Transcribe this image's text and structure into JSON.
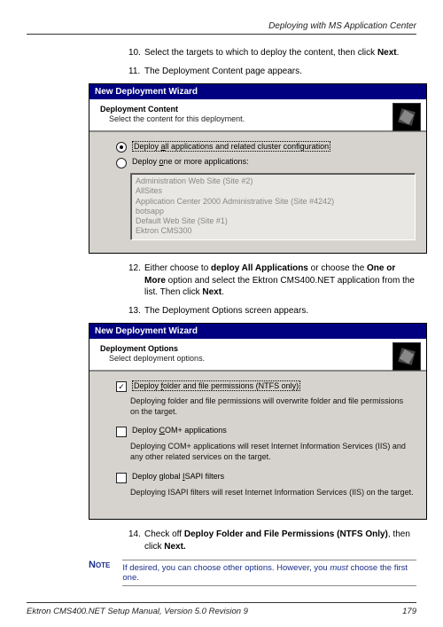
{
  "doc_header": "Deploying with MS Application Center",
  "steps": {
    "s10": {
      "num": "10.",
      "text_a": "Select the targets to which to deploy the content, then click ",
      "text_b": "Next",
      "text_c": "."
    },
    "s11": {
      "num": "11.",
      "text": "The Deployment Content page appears."
    },
    "s12": {
      "num": "12.",
      "text_a": "Either choose to ",
      "text_b": "deploy All Applications",
      "text_c": " or choose the ",
      "text_d": "One or More",
      "text_e": " option and select the Ektron CMS400.NET application from the list. Then click ",
      "text_f": "Next",
      "text_g": "."
    },
    "s13": {
      "num": "13.",
      "text": "The Deployment Options screen appears."
    },
    "s14": {
      "num": "14.",
      "text_a": "Check off ",
      "text_b": "Deploy Folder and File Permissions (NTFS Only)",
      "text_c": ", then click ",
      "text_d": "Next.",
      "text_e": ""
    }
  },
  "wizard1": {
    "titlebar": "New Deployment Wizard",
    "title": "Deployment Content",
    "subtitle": "Select the content for this deployment.",
    "radio_all_a": "Deploy ",
    "radio_all_ul": "a",
    "radio_all_b": "ll applications and related cluster configuration",
    "radio_one_a": "Deploy ",
    "radio_one_ul": "o",
    "radio_one_b": "ne or more applications:",
    "list_items": [
      "Administration Web Site (Site #2)",
      "AllSites",
      "Application Center 2000 Administrative Site (Site #4242)",
      "botsapp",
      "Default Web Site (Site #1)",
      "Ektron CMS300"
    ]
  },
  "wizard2": {
    "titlebar": "New Deployment Wizard",
    "title": "Deployment Options",
    "subtitle": "Select deployment options.",
    "chk1_a": "Deploy ",
    "chk1_ul": "f",
    "chk1_b": "older and file permissions (NTFS only)",
    "chk1_desc": "Deploying folder and file permissions will overwrite folder and file permissions on the target.",
    "chk2_a": "Deploy ",
    "chk2_ul": "C",
    "chk2_b": "OM+ applications",
    "chk2_desc": "Deploying COM+ applications will reset Internet Information Services (IIS) and any other related services on the target.",
    "chk3_a": "Deploy global ",
    "chk3_ul": "I",
    "chk3_b": "SAPI filters",
    "chk3_desc": "Deploying ISAPI filters will reset Internet Information Services (IIS) on the target."
  },
  "note": {
    "label": "Note",
    "text_a": "If desired, you can choose other options. However, you ",
    "text_b": "must",
    "text_c": " choose the first one."
  },
  "footer_left": "Ektron CMS400.NET Setup Manual, Version 5.0 Revision 9",
  "footer_right": "179"
}
